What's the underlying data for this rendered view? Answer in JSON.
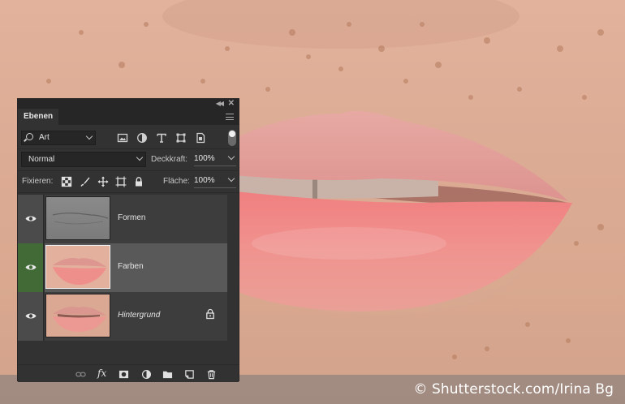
{
  "photo": {
    "subject": "lips-closeup"
  },
  "credit": {
    "text": "© Shutterstock.com/Irina Bg"
  },
  "panel": {
    "tab_label": "Ebenen",
    "filter": {
      "value": "Art"
    },
    "filter_icons": [
      "image-filter-icon",
      "adjustment-filter-icon",
      "type-filter-icon",
      "shape-filter-icon",
      "smart-object-filter-icon"
    ],
    "blend_mode": "Normal",
    "opacity_label": "Deckkraft:",
    "opacity_value": "100%",
    "lock_label": "Fixieren:",
    "fill_label": "Fläche:",
    "fill_value": "100%",
    "layers": [
      {
        "name": "Formen",
        "visible": true,
        "selected": false,
        "locked": false,
        "italic": false
      },
      {
        "name": "Farben",
        "visible": true,
        "selected": true,
        "locked": false,
        "italic": false
      },
      {
        "name": "Hintergrund",
        "visible": true,
        "selected": false,
        "locked": true,
        "italic": true
      }
    ],
    "bottom_icons": [
      "link-layers-icon",
      "fx-icon",
      "add-mask-icon",
      "adjustment-layer-icon",
      "group-folder-icon",
      "new-layer-icon",
      "trash-icon"
    ],
    "fx_label": "fx"
  },
  "colors": {
    "panel_bg": "#323232",
    "selected_eye": "#426a36",
    "selected_row": "#595959"
  }
}
